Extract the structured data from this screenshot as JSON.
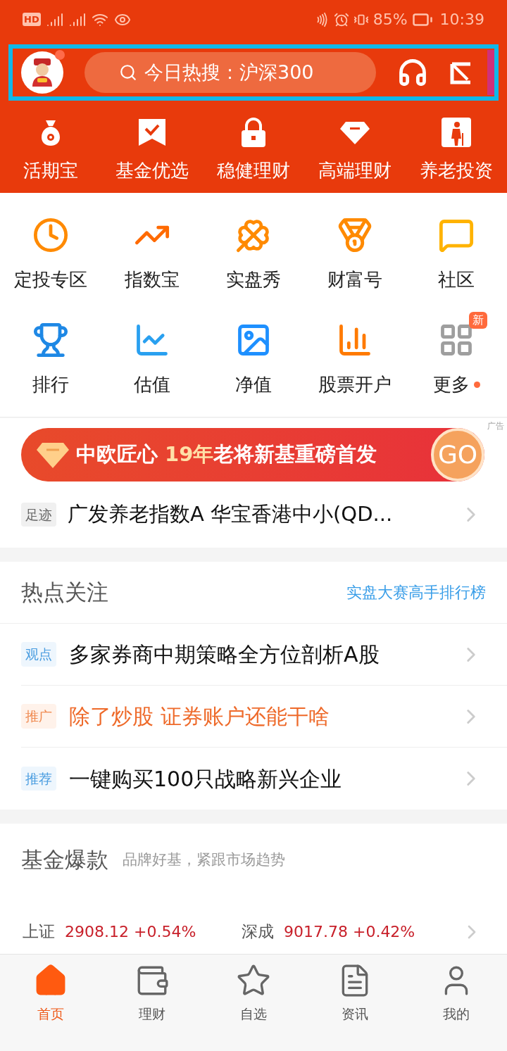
{
  "status_bar": {
    "hd": "HD",
    "battery": "85%",
    "time": "10:39"
  },
  "header": {
    "search": {
      "placeholder": "今日热搜：沪深300"
    },
    "avatar_badge": true
  },
  "top_nav": [
    {
      "label": "活期宝"
    },
    {
      "label": "基金优选"
    },
    {
      "label": "稳健理财"
    },
    {
      "label": "高端理财"
    },
    {
      "label": "养老投资"
    }
  ],
  "services": [
    {
      "label": "定投专区"
    },
    {
      "label": "指数宝"
    },
    {
      "label": "实盘秀"
    },
    {
      "label": "财富号"
    },
    {
      "label": "社区"
    },
    {
      "label": "排行"
    },
    {
      "label": "估值"
    },
    {
      "label": "净值"
    },
    {
      "label": "股票开户"
    },
    {
      "label": "更多",
      "badge": "新",
      "dot": true
    }
  ],
  "ad": {
    "label": "广告",
    "segments": [
      {
        "text": "中欧匠心 ",
        "highlight": false
      },
      {
        "text": "19年",
        "highlight": true
      },
      {
        "text": "老将新基重磅首发",
        "highlight": false
      }
    ],
    "button": "GO"
  },
  "footprint": {
    "tag": "足迹",
    "text": "广发养老指数A  华宝香港中小(QD..."
  },
  "hot": {
    "title": "热点关注",
    "link": "实盘大赛高手排行榜",
    "items": [
      {
        "tag": "观点",
        "text": "多家券商中期策略全方位剖析A股",
        "promoted": false
      },
      {
        "tag": "推广",
        "text": "除了炒股 证券账户还能干啥",
        "promoted": true
      },
      {
        "tag": "推荐",
        "text": "一键购买100只战略新兴企业",
        "promoted": false
      }
    ]
  },
  "funds": {
    "title": "基金爆款",
    "subtitle": "品牌好基，紧跟市场趋势"
  },
  "ticker": [
    {
      "name": "上证",
      "value": "2908.12 +0.54%"
    },
    {
      "name": "深成",
      "value": "9017.78 +0.42%"
    }
  ],
  "tabs": [
    {
      "label": "首页",
      "selected": true
    },
    {
      "label": "理财",
      "selected": false
    },
    {
      "label": "自选",
      "selected": false
    },
    {
      "label": "资讯",
      "selected": false
    },
    {
      "label": "我的",
      "selected": false
    }
  ]
}
